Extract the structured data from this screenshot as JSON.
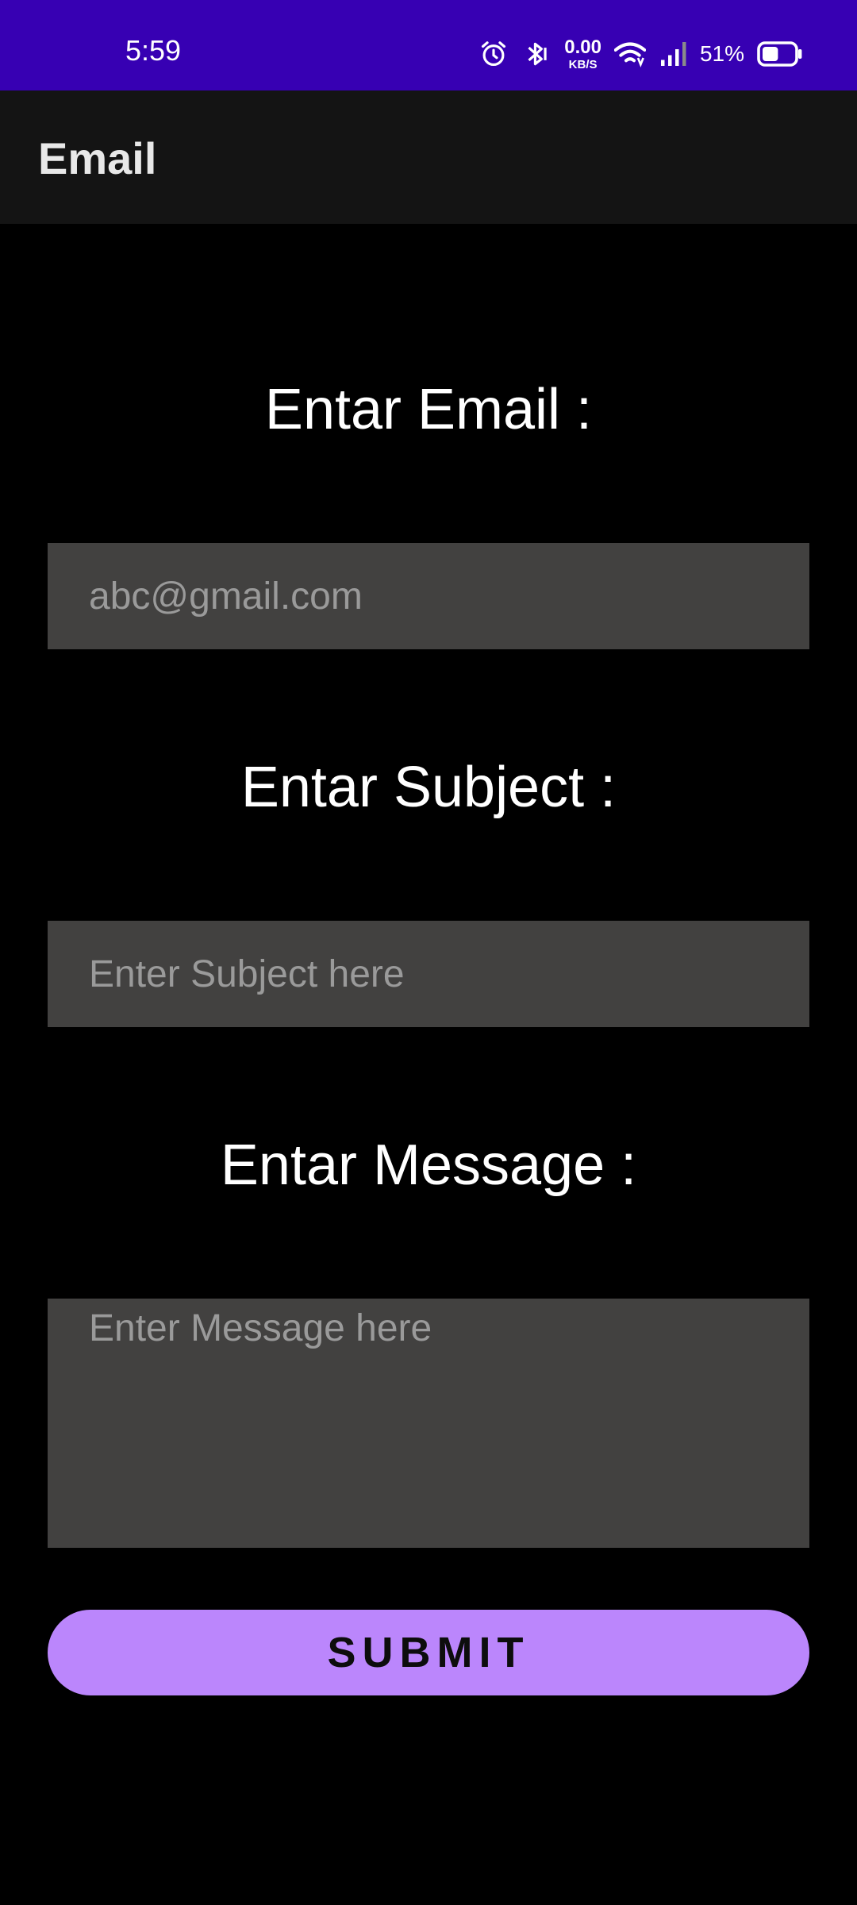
{
  "status_bar": {
    "time": "5:59",
    "speed_value": "0.00",
    "speed_unit": "KB/S",
    "battery_percent": "51%",
    "battery_level": 0.51,
    "background_color": "#3700b3",
    "icons": [
      "alarm-icon",
      "bluetooth-icon",
      "wifi-icon",
      "signal-icon",
      "battery-icon"
    ]
  },
  "app_bar": {
    "title": "Email"
  },
  "form": {
    "email_label": "Entar Email :",
    "email_placeholder": "abc@gmail.com",
    "subject_label": "Entar Subject :",
    "subject_placeholder": "Enter Subject here",
    "message_label": "Entar Message :",
    "message_placeholder": "Enter Message here",
    "submit_label": "SUBMIT",
    "accent_color": "#bb86fc"
  }
}
